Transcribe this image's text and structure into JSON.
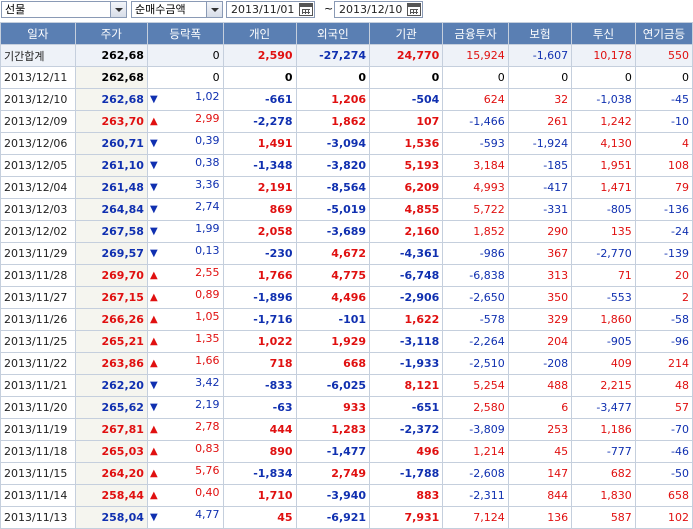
{
  "toolbar": {
    "market": "선물",
    "mode": "순매수금액",
    "date_from": "2013/11/01",
    "date_sep": "~",
    "date_to": "2013/12/10"
  },
  "columns": [
    "일자",
    "주가",
    "등락폭",
    "개인",
    "외국인",
    "기관",
    "금융투자",
    "보험",
    "투신",
    "연기금등"
  ],
  "summary": {
    "label": "기간합계",
    "price": "262,68",
    "change": "0",
    "individual": "2,590",
    "foreign": "-27,274",
    "institution": "24,770",
    "fin_invest": "15,924",
    "insurance": "-1,607",
    "trust": "10,178",
    "pension": "550"
  },
  "rows": [
    {
      "date": "2013/12/11",
      "price": "262,68",
      "dir": "",
      "change": "0",
      "individual": "0",
      "foreign": "0",
      "institution": "0",
      "fin_invest": "0",
      "insurance": "0",
      "trust": "0",
      "pension": "0"
    },
    {
      "date": "2013/12/10",
      "price": "262,68",
      "dir": "down",
      "change": "1,02",
      "individual": "-661",
      "foreign": "1,206",
      "institution": "-504",
      "fin_invest": "624",
      "insurance": "32",
      "trust": "-1,038",
      "pension": "-45"
    },
    {
      "date": "2013/12/09",
      "price": "263,70",
      "dir": "up",
      "change": "2,99",
      "individual": "-2,278",
      "foreign": "1,862",
      "institution": "107",
      "fin_invest": "-1,466",
      "insurance": "261",
      "trust": "1,242",
      "pension": "-10"
    },
    {
      "date": "2013/12/06",
      "price": "260,71",
      "dir": "down",
      "change": "0,39",
      "individual": "1,491",
      "foreign": "-3,094",
      "institution": "1,536",
      "fin_invest": "-593",
      "insurance": "-1,924",
      "trust": "4,130",
      "pension": "4"
    },
    {
      "date": "2013/12/05",
      "price": "261,10",
      "dir": "down",
      "change": "0,38",
      "individual": "-1,348",
      "foreign": "-3,820",
      "institution": "5,193",
      "fin_invest": "3,184",
      "insurance": "-185",
      "trust": "1,951",
      "pension": "108"
    },
    {
      "date": "2013/12/04",
      "price": "261,48",
      "dir": "down",
      "change": "3,36",
      "individual": "2,191",
      "foreign": "-8,564",
      "institution": "6,209",
      "fin_invest": "4,993",
      "insurance": "-417",
      "trust": "1,471",
      "pension": "79"
    },
    {
      "date": "2013/12/03",
      "price": "264,84",
      "dir": "down",
      "change": "2,74",
      "individual": "869",
      "foreign": "-5,019",
      "institution": "4,855",
      "fin_invest": "5,722",
      "insurance": "-331",
      "trust": "-805",
      "pension": "-136"
    },
    {
      "date": "2013/12/02",
      "price": "267,58",
      "dir": "down",
      "change": "1,99",
      "individual": "2,058",
      "foreign": "-3,689",
      "institution": "2,160",
      "fin_invest": "1,852",
      "insurance": "290",
      "trust": "135",
      "pension": "-24"
    },
    {
      "date": "2013/11/29",
      "price": "269,57",
      "dir": "down",
      "change": "0,13",
      "individual": "-230",
      "foreign": "4,672",
      "institution": "-4,361",
      "fin_invest": "-986",
      "insurance": "367",
      "trust": "-2,770",
      "pension": "-139"
    },
    {
      "date": "2013/11/28",
      "price": "269,70",
      "dir": "up",
      "change": "2,55",
      "individual": "1,766",
      "foreign": "4,775",
      "institution": "-6,748",
      "fin_invest": "-6,838",
      "insurance": "313",
      "trust": "71",
      "pension": "20"
    },
    {
      "date": "2013/11/27",
      "price": "267,15",
      "dir": "up",
      "change": "0,89",
      "individual": "-1,896",
      "foreign": "4,496",
      "institution": "-2,906",
      "fin_invest": "-2,650",
      "insurance": "350",
      "trust": "-553",
      "pension": "2"
    },
    {
      "date": "2013/11/26",
      "price": "266,26",
      "dir": "up",
      "change": "1,05",
      "individual": "-1,716",
      "foreign": "-101",
      "institution": "1,622",
      "fin_invest": "-578",
      "insurance": "329",
      "trust": "1,860",
      "pension": "-58"
    },
    {
      "date": "2013/11/25",
      "price": "265,21",
      "dir": "up",
      "change": "1,35",
      "individual": "1,022",
      "foreign": "1,929",
      "institution": "-3,118",
      "fin_invest": "-2,264",
      "insurance": "204",
      "trust": "-905",
      "pension": "-96"
    },
    {
      "date": "2013/11/22",
      "price": "263,86",
      "dir": "up",
      "change": "1,66",
      "individual": "718",
      "foreign": "668",
      "institution": "-1,933",
      "fin_invest": "-2,510",
      "insurance": "-208",
      "trust": "409",
      "pension": "214"
    },
    {
      "date": "2013/11/21",
      "price": "262,20",
      "dir": "down",
      "change": "3,42",
      "individual": "-833",
      "foreign": "-6,025",
      "institution": "8,121",
      "fin_invest": "5,254",
      "insurance": "488",
      "trust": "2,215",
      "pension": "48"
    },
    {
      "date": "2013/11/20",
      "price": "265,62",
      "dir": "down",
      "change": "2,19",
      "individual": "-63",
      "foreign": "933",
      "institution": "-651",
      "fin_invest": "2,580",
      "insurance": "6",
      "trust": "-3,477",
      "pension": "57"
    },
    {
      "date": "2013/11/19",
      "price": "267,81",
      "dir": "up",
      "change": "2,78",
      "individual": "444",
      "foreign": "1,283",
      "institution": "-2,372",
      "fin_invest": "-3,809",
      "insurance": "253",
      "trust": "1,186",
      "pension": "-70"
    },
    {
      "date": "2013/11/18",
      "price": "265,03",
      "dir": "up",
      "change": "0,83",
      "individual": "890",
      "foreign": "-1,477",
      "institution": "496",
      "fin_invest": "1,214",
      "insurance": "45",
      "trust": "-777",
      "pension": "-46"
    },
    {
      "date": "2013/11/15",
      "price": "264,20",
      "dir": "up",
      "change": "5,76",
      "individual": "-1,834",
      "foreign": "2,749",
      "institution": "-1,788",
      "fin_invest": "-2,608",
      "insurance": "147",
      "trust": "682",
      "pension": "-50"
    },
    {
      "date": "2013/11/14",
      "price": "258,44",
      "dir": "up",
      "change": "0,40",
      "individual": "1,710",
      "foreign": "-3,940",
      "institution": "883",
      "fin_invest": "-2,311",
      "insurance": "844",
      "trust": "1,830",
      "pension": "658"
    },
    {
      "date": "2013/11/13",
      "price": "258,04",
      "dir": "down",
      "change": "4,77",
      "individual": "45",
      "foreign": "-6,921",
      "institution": "7,931",
      "fin_invest": "7,124",
      "insurance": "136",
      "trust": "587",
      "pension": "102"
    }
  ],
  "colors": {
    "header_bg": "#5a7fb3",
    "up": "#e01010",
    "down": "#1030b0",
    "grid_line": "#c5cfdd"
  }
}
